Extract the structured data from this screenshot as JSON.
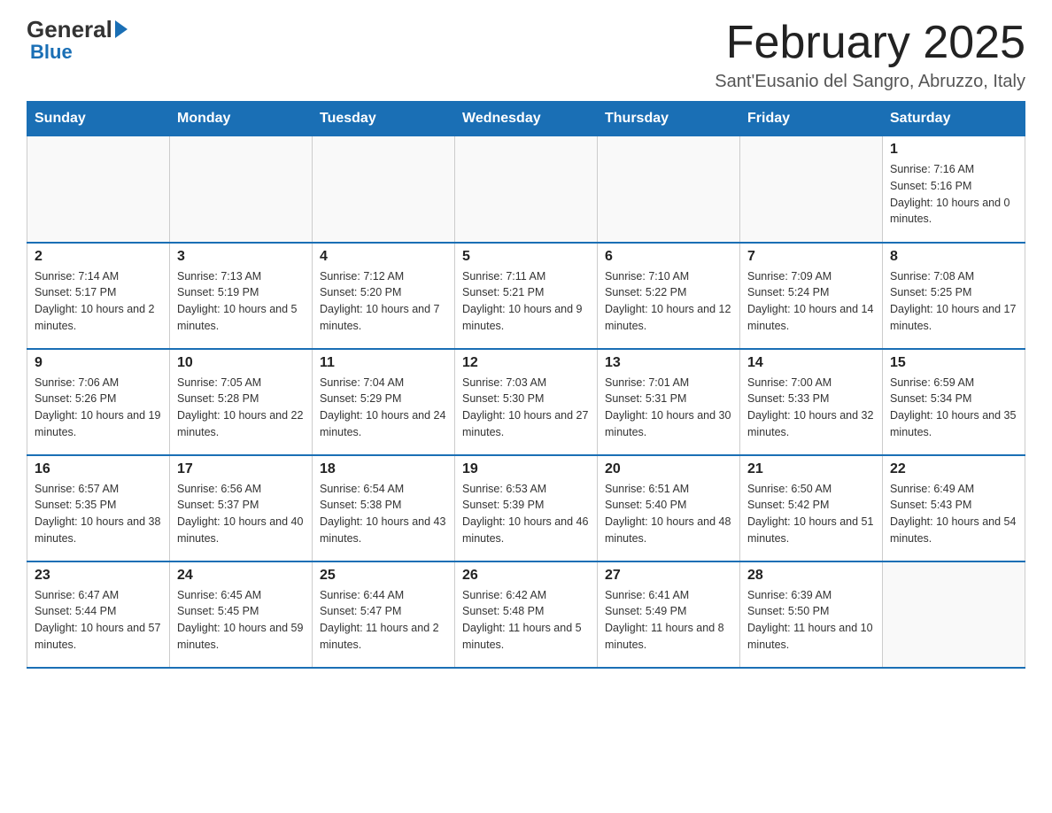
{
  "logo": {
    "general": "General",
    "blue": "Blue"
  },
  "header": {
    "month_title": "February 2025",
    "location": "Sant'Eusanio del Sangro, Abruzzo, Italy"
  },
  "days_of_week": [
    "Sunday",
    "Monday",
    "Tuesday",
    "Wednesday",
    "Thursday",
    "Friday",
    "Saturday"
  ],
  "weeks": [
    [
      {
        "day": "",
        "info": ""
      },
      {
        "day": "",
        "info": ""
      },
      {
        "day": "",
        "info": ""
      },
      {
        "day": "",
        "info": ""
      },
      {
        "day": "",
        "info": ""
      },
      {
        "day": "",
        "info": ""
      },
      {
        "day": "1",
        "info": "Sunrise: 7:16 AM\nSunset: 5:16 PM\nDaylight: 10 hours and 0 minutes."
      }
    ],
    [
      {
        "day": "2",
        "info": "Sunrise: 7:14 AM\nSunset: 5:17 PM\nDaylight: 10 hours and 2 minutes."
      },
      {
        "day": "3",
        "info": "Sunrise: 7:13 AM\nSunset: 5:19 PM\nDaylight: 10 hours and 5 minutes."
      },
      {
        "day": "4",
        "info": "Sunrise: 7:12 AM\nSunset: 5:20 PM\nDaylight: 10 hours and 7 minutes."
      },
      {
        "day": "5",
        "info": "Sunrise: 7:11 AM\nSunset: 5:21 PM\nDaylight: 10 hours and 9 minutes."
      },
      {
        "day": "6",
        "info": "Sunrise: 7:10 AM\nSunset: 5:22 PM\nDaylight: 10 hours and 12 minutes."
      },
      {
        "day": "7",
        "info": "Sunrise: 7:09 AM\nSunset: 5:24 PM\nDaylight: 10 hours and 14 minutes."
      },
      {
        "day": "8",
        "info": "Sunrise: 7:08 AM\nSunset: 5:25 PM\nDaylight: 10 hours and 17 minutes."
      }
    ],
    [
      {
        "day": "9",
        "info": "Sunrise: 7:06 AM\nSunset: 5:26 PM\nDaylight: 10 hours and 19 minutes."
      },
      {
        "day": "10",
        "info": "Sunrise: 7:05 AM\nSunset: 5:28 PM\nDaylight: 10 hours and 22 minutes."
      },
      {
        "day": "11",
        "info": "Sunrise: 7:04 AM\nSunset: 5:29 PM\nDaylight: 10 hours and 24 minutes."
      },
      {
        "day": "12",
        "info": "Sunrise: 7:03 AM\nSunset: 5:30 PM\nDaylight: 10 hours and 27 minutes."
      },
      {
        "day": "13",
        "info": "Sunrise: 7:01 AM\nSunset: 5:31 PM\nDaylight: 10 hours and 30 minutes."
      },
      {
        "day": "14",
        "info": "Sunrise: 7:00 AM\nSunset: 5:33 PM\nDaylight: 10 hours and 32 minutes."
      },
      {
        "day": "15",
        "info": "Sunrise: 6:59 AM\nSunset: 5:34 PM\nDaylight: 10 hours and 35 minutes."
      }
    ],
    [
      {
        "day": "16",
        "info": "Sunrise: 6:57 AM\nSunset: 5:35 PM\nDaylight: 10 hours and 38 minutes."
      },
      {
        "day": "17",
        "info": "Sunrise: 6:56 AM\nSunset: 5:37 PM\nDaylight: 10 hours and 40 minutes."
      },
      {
        "day": "18",
        "info": "Sunrise: 6:54 AM\nSunset: 5:38 PM\nDaylight: 10 hours and 43 minutes."
      },
      {
        "day": "19",
        "info": "Sunrise: 6:53 AM\nSunset: 5:39 PM\nDaylight: 10 hours and 46 minutes."
      },
      {
        "day": "20",
        "info": "Sunrise: 6:51 AM\nSunset: 5:40 PM\nDaylight: 10 hours and 48 minutes."
      },
      {
        "day": "21",
        "info": "Sunrise: 6:50 AM\nSunset: 5:42 PM\nDaylight: 10 hours and 51 minutes."
      },
      {
        "day": "22",
        "info": "Sunrise: 6:49 AM\nSunset: 5:43 PM\nDaylight: 10 hours and 54 minutes."
      }
    ],
    [
      {
        "day": "23",
        "info": "Sunrise: 6:47 AM\nSunset: 5:44 PM\nDaylight: 10 hours and 57 minutes."
      },
      {
        "day": "24",
        "info": "Sunrise: 6:45 AM\nSunset: 5:45 PM\nDaylight: 10 hours and 59 minutes."
      },
      {
        "day": "25",
        "info": "Sunrise: 6:44 AM\nSunset: 5:47 PM\nDaylight: 11 hours and 2 minutes."
      },
      {
        "day": "26",
        "info": "Sunrise: 6:42 AM\nSunset: 5:48 PM\nDaylight: 11 hours and 5 minutes."
      },
      {
        "day": "27",
        "info": "Sunrise: 6:41 AM\nSunset: 5:49 PM\nDaylight: 11 hours and 8 minutes."
      },
      {
        "day": "28",
        "info": "Sunrise: 6:39 AM\nSunset: 5:50 PM\nDaylight: 11 hours and 10 minutes."
      },
      {
        "day": "",
        "info": ""
      }
    ]
  ]
}
